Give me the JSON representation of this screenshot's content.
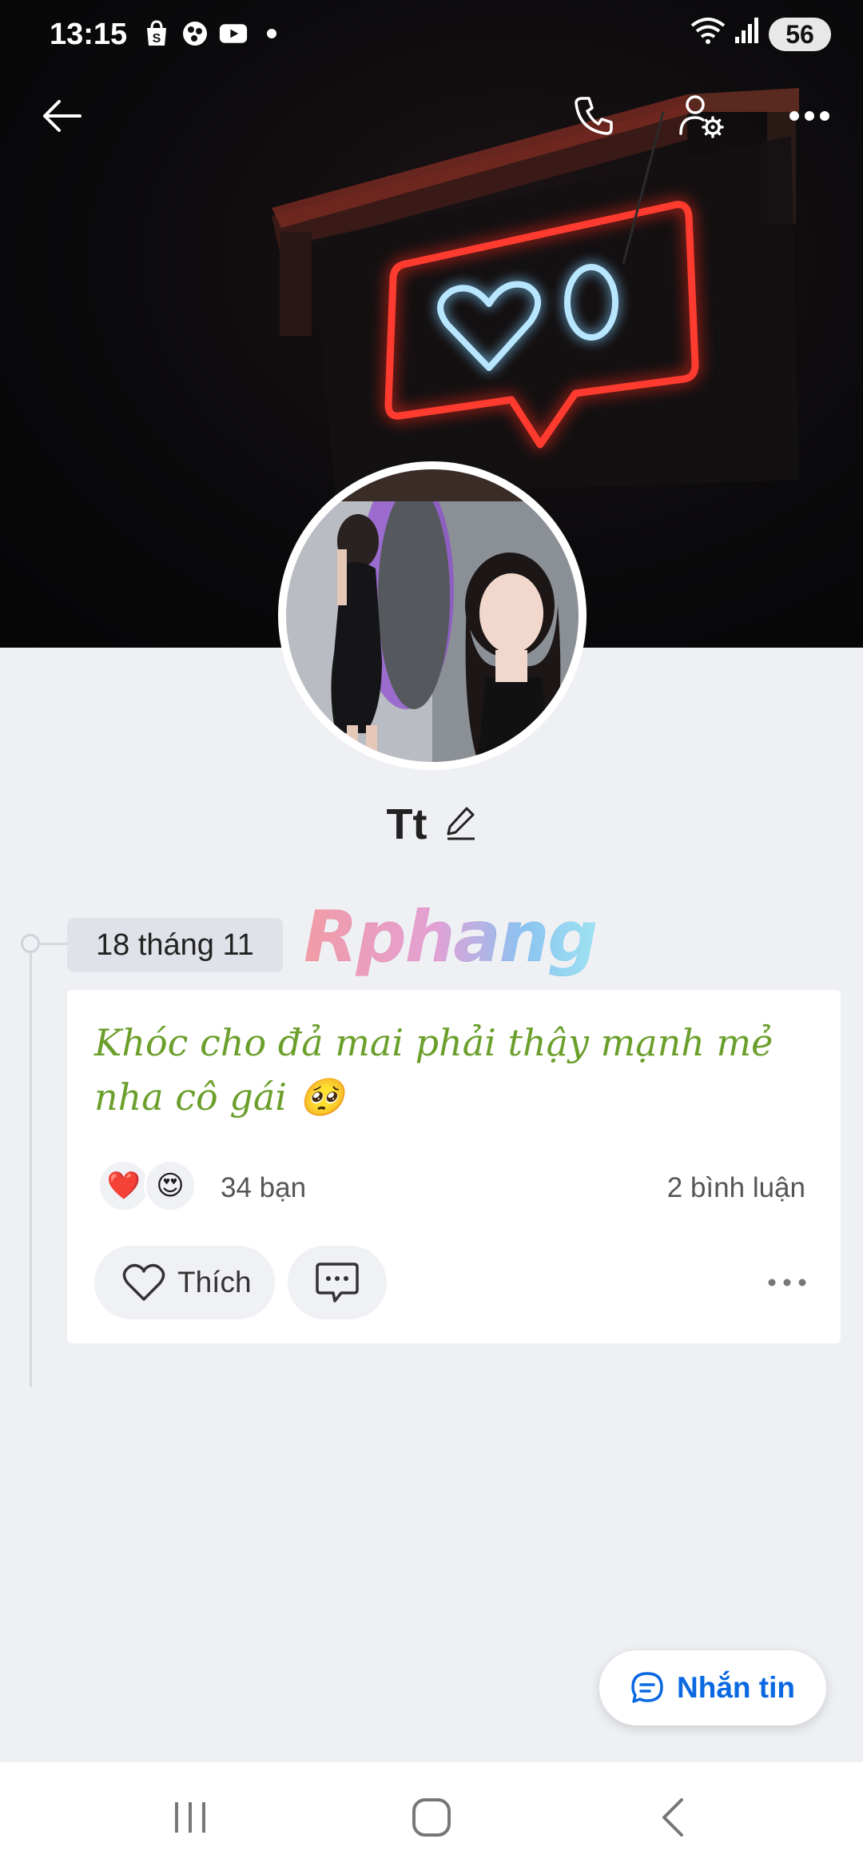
{
  "status_bar": {
    "time": "13:15",
    "notification_icons": [
      "shopee-icon",
      "app-icon",
      "youtube-icon",
      "dot-icon"
    ],
    "battery": "56"
  },
  "top_nav": {
    "back_icon": "arrow-left-icon",
    "call_icon": "phone-icon",
    "settings_icon": "user-settings-icon",
    "more_icon": "more-horizontal-icon"
  },
  "profile": {
    "name": "Tt",
    "edit_icon": "pencil-icon"
  },
  "timeline": {
    "date": "18 tháng 11",
    "watermark": "Rphang"
  },
  "post": {
    "text": "Khóc cho đả mai phải thậy mạnh mẻ nha cô gái 🥺",
    "reactions": [
      "❤️",
      "😍"
    ],
    "reaction_count": "34 bạn",
    "comment_count": "2 bình luận",
    "like_label": "Thích"
  },
  "message_button": {
    "label": "Nhắn tin"
  },
  "colors": {
    "accent_blue": "#0a68e0",
    "post_text_green": "#6b9f2c",
    "background": "#eef0f4"
  }
}
